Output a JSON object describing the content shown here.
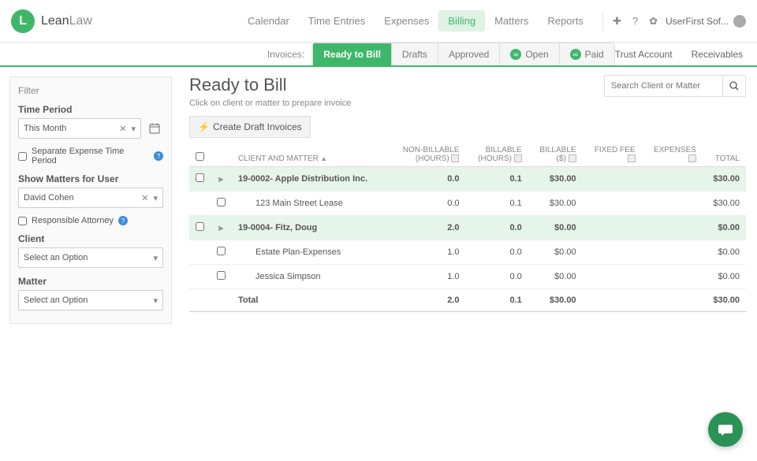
{
  "brand": {
    "badge": "L",
    "text1": "Lean",
    "text2": "Law"
  },
  "topnav": {
    "items": [
      "Calendar",
      "Time Entries",
      "Expenses",
      "Billing",
      "Matters",
      "Reports"
    ],
    "active": "Billing"
  },
  "user": {
    "label": "UserFirst Sof..."
  },
  "subnav": {
    "label": "Invoices:",
    "tabs": [
      "Ready to Bill",
      "Drafts",
      "Approved",
      "Open",
      "Paid"
    ],
    "active": "Ready to Bill",
    "badge": "∞",
    "right": [
      "Trust Account",
      "Receivables"
    ]
  },
  "filter": {
    "title": "Filter",
    "time_period_label": "Time Period",
    "time_period_value": "This Month",
    "separate_label": "Separate Expense Time Period",
    "show_matters_label": "Show Matters for User",
    "user_value": "David Cohen",
    "responsible_label": "Responsible Attorney",
    "client_label": "Client",
    "client_value": "Select an Option",
    "matter_label": "Matter",
    "matter_value": "Select an Option"
  },
  "main": {
    "title": "Ready to Bill",
    "subtitle": "Click on client or matter to prepare invoice",
    "create_btn": "Create Draft Invoices",
    "search_placeholder": "Search Client or Matter"
  },
  "columns": {
    "client": "CLIENT AND MATTER",
    "nonbill1": "NON-BILLABLE",
    "nonbill2": "(HOURS)",
    "bill_h1": "BILLABLE",
    "bill_h2": "(HOURS)",
    "bill_d1": "BILLABLE",
    "bill_d2": "($)",
    "fixed": "FIXED FEE",
    "expenses": "EXPENSES",
    "total": "TOTAL"
  },
  "rows": {
    "g1": {
      "name": "19-0002- Apple Distribution Inc.",
      "nb": "0.0",
      "bh": "0.1",
      "bd": "$30.00",
      "ff": "",
      "ex": "",
      "tot": "$30.00"
    },
    "r1": {
      "name": "123 Main Street Lease",
      "nb": "0.0",
      "bh": "0.1",
      "bd": "$30.00",
      "ff": "",
      "ex": "",
      "tot": "$30.00"
    },
    "g2": {
      "name": "19-0004- Fitz, Doug",
      "nb": "2.0",
      "bh": "0.0",
      "bd": "$0.00",
      "ff": "",
      "ex": "",
      "tot": "$0.00"
    },
    "r2": {
      "name": "Estate Plan-Expenses",
      "nb": "1.0",
      "bh": "0.0",
      "bd": "$0.00",
      "ff": "",
      "ex": "",
      "tot": "$0.00"
    },
    "r3": {
      "name": "Jessica Simpson",
      "nb": "1.0",
      "bh": "0.0",
      "bd": "$0.00",
      "ff": "",
      "ex": "",
      "tot": "$0.00"
    },
    "total": {
      "name": "Total",
      "nb": "2.0",
      "bh": "0.1",
      "bd": "$30.00",
      "ff": "",
      "ex": "",
      "tot": "$30.00"
    }
  }
}
